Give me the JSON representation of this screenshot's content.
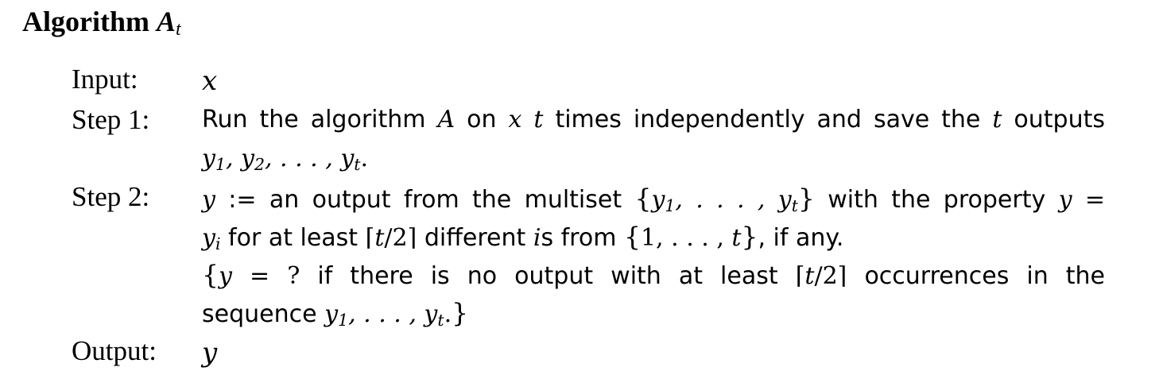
{
  "algorithm": {
    "title_word": "Algorithm",
    "title_var": "A",
    "title_sub": "t"
  },
  "labels": {
    "input": "Input:",
    "step1": "Step 1:",
    "step2": "Step 2:",
    "output": "Output:"
  },
  "input_value": "x",
  "output_value": "y",
  "step1": {
    "line1_a": "Run the algorithm",
    "line1_b": "on",
    "line1_c": "times independently and save the",
    "line1_d": "outputs"
  },
  "step2": {
    "line1_a": ":= an output from the multiset",
    "line1_b": "with the property",
    "line2_a": "for at least",
    "line2_b": "different",
    "line2_c": "s from",
    "line2_d": ", if any.",
    "line3_a": "if there is no output with at least",
    "line3_b": "occurrences in the",
    "line4_a": "sequence"
  }
}
